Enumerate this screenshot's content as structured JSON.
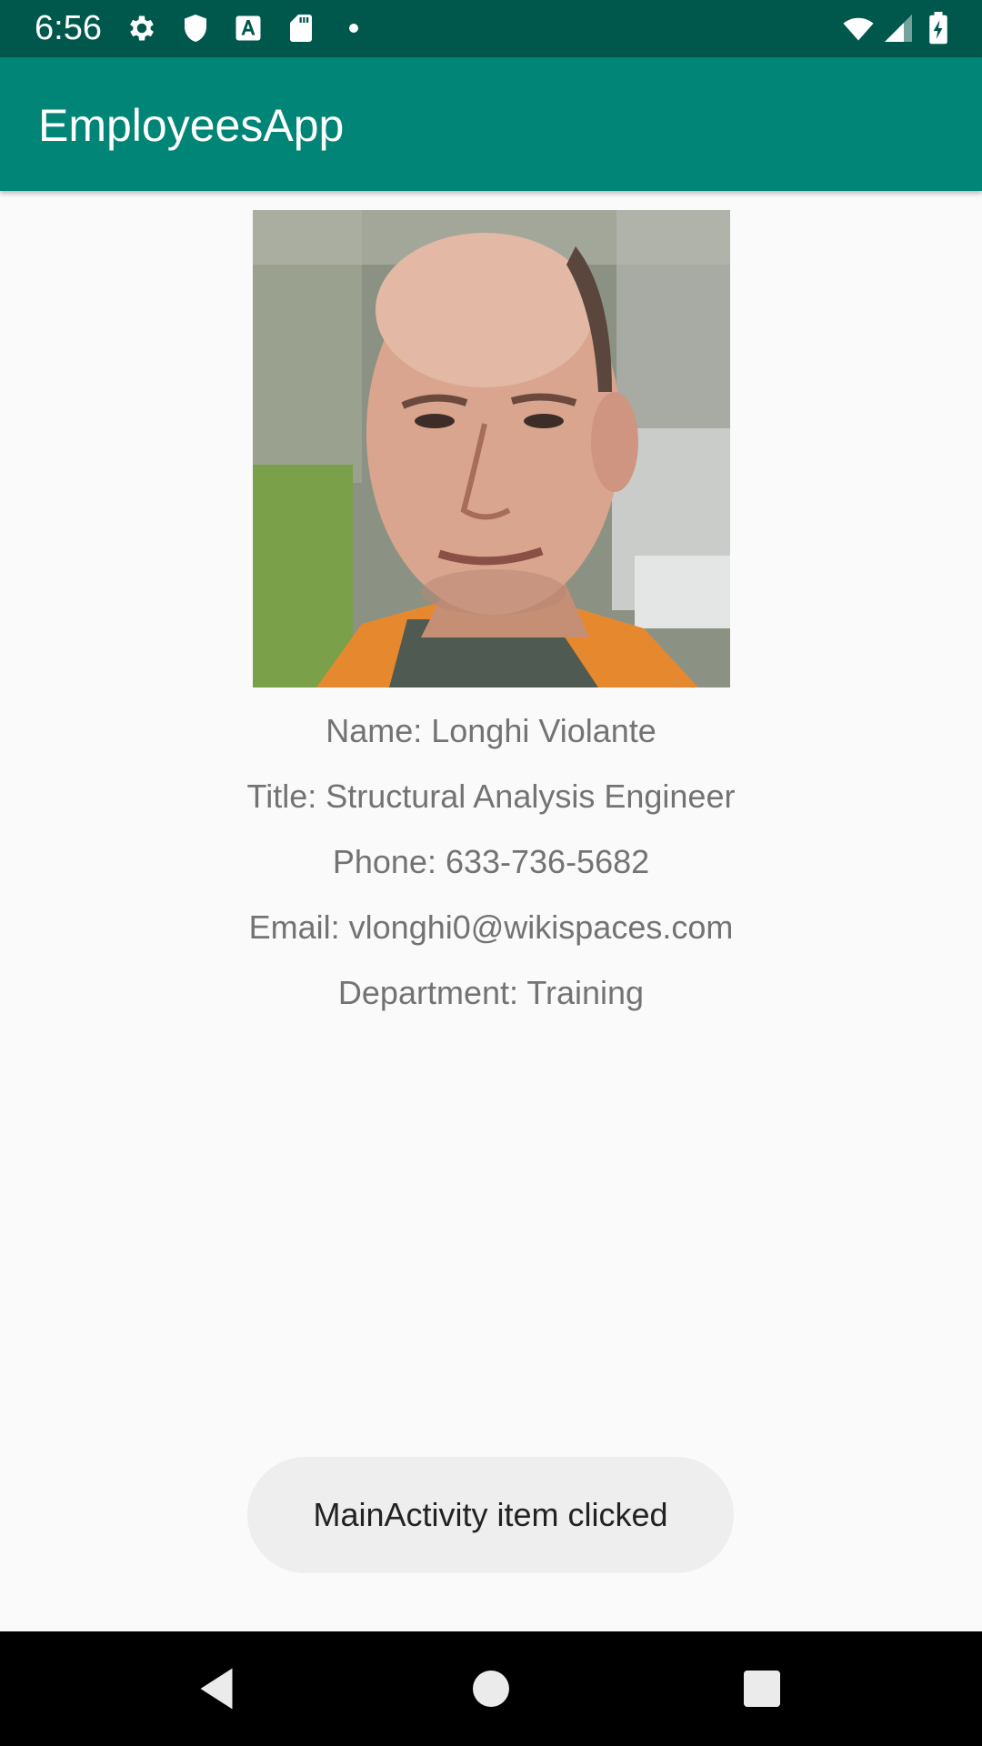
{
  "status_bar": {
    "time": "6:56",
    "left_icons": [
      "gear-icon",
      "shield-icon",
      "font-download-icon",
      "sd-card-icon",
      "notification-dot-icon"
    ],
    "right_icons": [
      "wifi-icon",
      "cell-signal-icon",
      "battery-charging-icon"
    ]
  },
  "app_bar": {
    "title": "EmployeesApp",
    "color": "#008577"
  },
  "employee": {
    "photo_icon": "employee-photo",
    "name_line": "Name: Longhi Violante",
    "title_line": "Title: Structural Analysis Engineer",
    "phone_line": "Phone: 633-736-5682",
    "email_line": "Email: vlonghi0@wikispaces.com",
    "department_line": "Department: Training"
  },
  "toast": {
    "message": "MainActivity item clicked"
  },
  "nav_bar": {
    "buttons": [
      "back-icon",
      "home-icon",
      "recents-icon"
    ]
  },
  "colors": {
    "status_bar": "#00574b",
    "app_bar": "#008577",
    "background": "#fafafa",
    "text": "#737373"
  }
}
